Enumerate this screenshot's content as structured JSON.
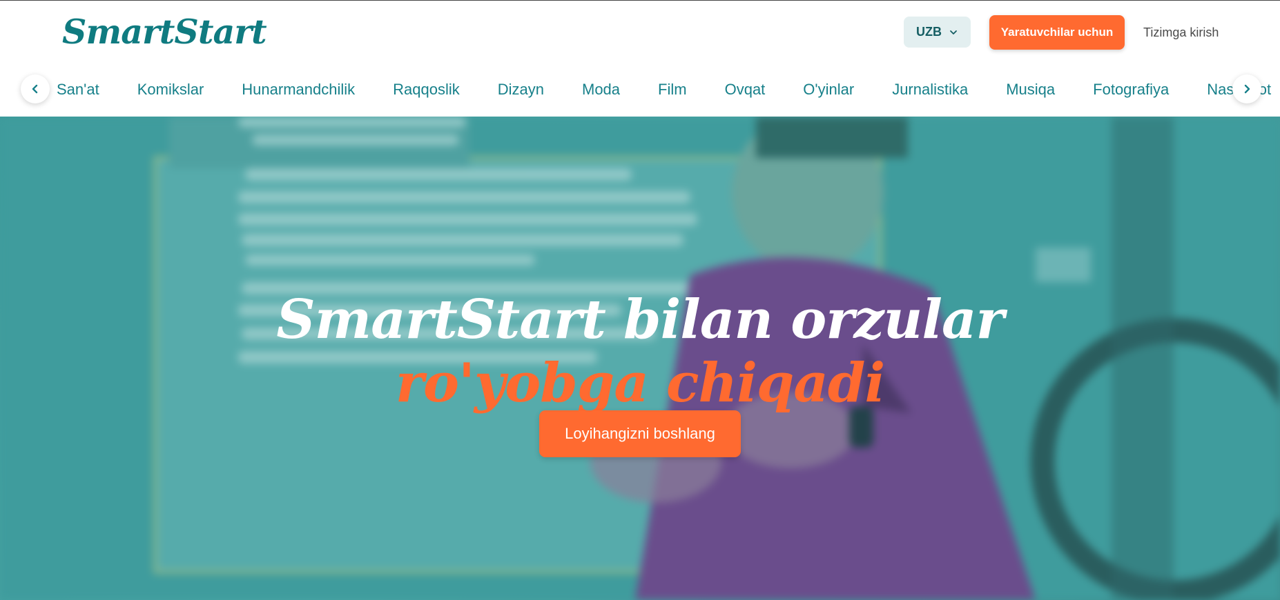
{
  "header": {
    "logo": "SmartStart",
    "language": "UZB",
    "creators_button": "Yaratuvchilar uchun",
    "login_link": "Tizimga kirish"
  },
  "categories": {
    "items": [
      {
        "label": "San'at"
      },
      {
        "label": "Komikslar"
      },
      {
        "label": "Hunarmandchilik"
      },
      {
        "label": "Raqqoslik"
      },
      {
        "label": "Dizayn"
      },
      {
        "label": "Moda"
      },
      {
        "label": "Film"
      },
      {
        "label": "Ovqat"
      },
      {
        "label": "O'yinlar"
      },
      {
        "label": "Jurnalistika"
      },
      {
        "label": "Musiqa"
      },
      {
        "label": "Fotografiya"
      },
      {
        "label": "Nashriyot"
      }
    ],
    "prev_icon": "chevron-left-icon",
    "next_icon": "chevron-right-icon"
  },
  "hero": {
    "title_line1": "SmartStart bilan orzular",
    "title_line2": "ro'yobga chiqadi",
    "cta_label": "Loyihangizni boshlang"
  },
  "colors": {
    "brand_teal": "#0f7b80",
    "accent_orange": "#ff6a30",
    "hero_overlay": "#3c9a9b"
  }
}
